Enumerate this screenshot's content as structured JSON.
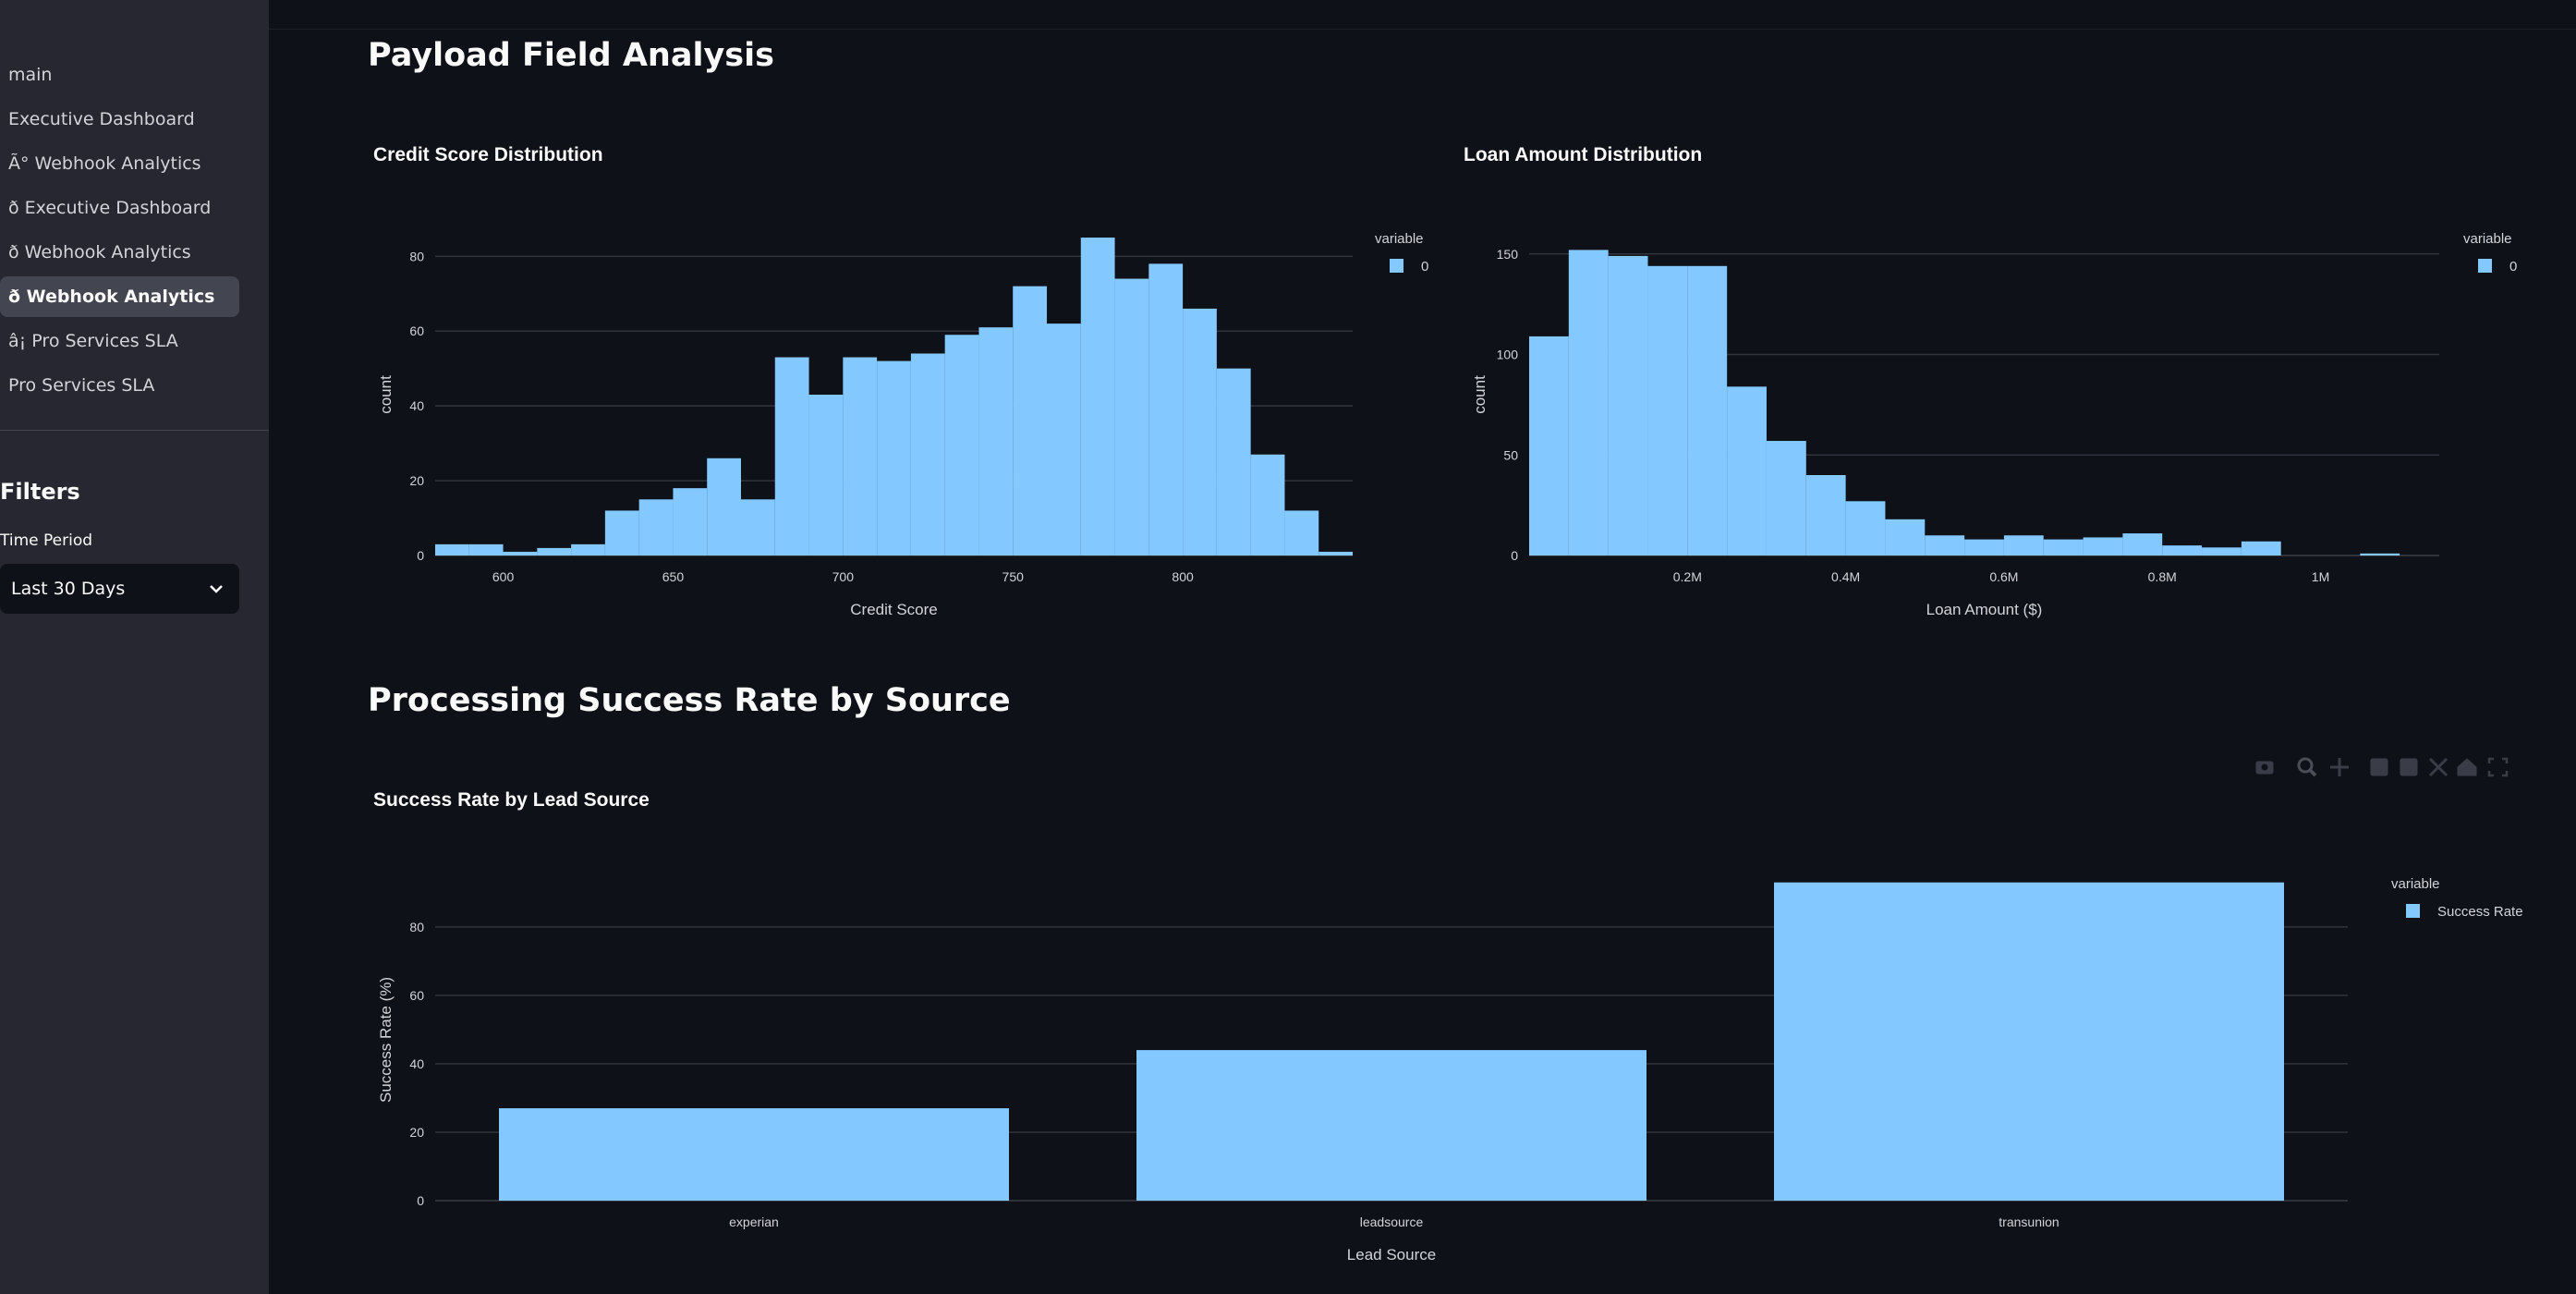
{
  "sidebar": {
    "nav_items": [
      {
        "label": "main"
      },
      {
        "label": "Executive Dashboard"
      },
      {
        "label": "Ã° Webhook Analytics"
      },
      {
        "label": "ð Executive Dashboard"
      },
      {
        "label": "ð Webhook Analytics"
      },
      {
        "label": "ð Webhook Analytics",
        "active": true
      },
      {
        "label": "â¡ Pro Services SLA"
      },
      {
        "label": "Pro Services SLA"
      }
    ],
    "filters_heading": "Filters",
    "time_period_label": "Time Period",
    "time_period_value": "Last 30 Days"
  },
  "main": {
    "section1_title": "Payload Field Analysis",
    "section2_title": "Processing Success Rate by Source"
  },
  "colors": {
    "background": "#0e1117",
    "sidebar": "#262730",
    "bar": "#83c9ff",
    "grid": "#31333f",
    "text": "#fafafa",
    "muted": "#d3d4d9"
  },
  "modebar_icons": [
    "camera-icon",
    "zoom-icon",
    "pan-icon",
    "zoom-in-icon",
    "zoom-out-icon",
    "autoscale-icon",
    "reset-axes-icon",
    "fullscreen-icon"
  ],
  "chart_data": [
    {
      "type": "bar",
      "subtype": "histogram",
      "title": "Credit Score Distribution",
      "xlabel": "Credit Score",
      "ylabel": "count",
      "xlim": [
        580,
        850
      ],
      "ylim": [
        0,
        86
      ],
      "x_ticks": [
        600,
        650,
        700,
        750,
        800
      ],
      "y_ticks": [
        0,
        20,
        40,
        60,
        80
      ],
      "bin_start": 580,
      "bin_width": 10,
      "legend": {
        "title": "variable",
        "items": [
          "0"
        ]
      },
      "series": [
        {
          "name": "0",
          "values": [
            3,
            3,
            1,
            2,
            3,
            12,
            15,
            18,
            26,
            15,
            53,
            43,
            53,
            52,
            54,
            59,
            61,
            72,
            62,
            85,
            74,
            78,
            66,
            50,
            27,
            12,
            1
          ]
        }
      ]
    },
    {
      "type": "bar",
      "subtype": "histogram",
      "title": "Loan Amount Distribution",
      "xlabel": "Loan Amount ($)",
      "ylabel": "count",
      "xlim": [
        0,
        1150000
      ],
      "ylim": [
        0,
        160
      ],
      "x_ticks": [
        200000,
        400000,
        600000,
        800000,
        1000000
      ],
      "x_tick_labels": [
        "0.2M",
        "0.4M",
        "0.6M",
        "0.8M",
        "1M"
      ],
      "y_ticks": [
        0,
        50,
        100,
        150
      ],
      "bin_start": 0,
      "bin_width": 50000,
      "legend": {
        "title": "variable",
        "items": [
          "0"
        ]
      },
      "series": [
        {
          "name": "0",
          "values": [
            109,
            152,
            149,
            144,
            144,
            84,
            57,
            40,
            27,
            18,
            10,
            8,
            10,
            8,
            9,
            11,
            5,
            4,
            7,
            0,
            0,
            1
          ]
        }
      ]
    },
    {
      "type": "bar",
      "title": "Success Rate by Lead Source",
      "xlabel": "Lead Source",
      "ylabel": "Success Rate (%)",
      "categories": [
        "experian",
        "leadsource",
        "transunion"
      ],
      "ylim": [
        0,
        94
      ],
      "y_ticks": [
        0,
        20,
        40,
        60,
        80
      ],
      "legend": {
        "title": "variable",
        "items": [
          "Success Rate"
        ]
      },
      "series": [
        {
          "name": "Success Rate",
          "values": [
            27,
            44,
            93
          ]
        }
      ]
    }
  ]
}
